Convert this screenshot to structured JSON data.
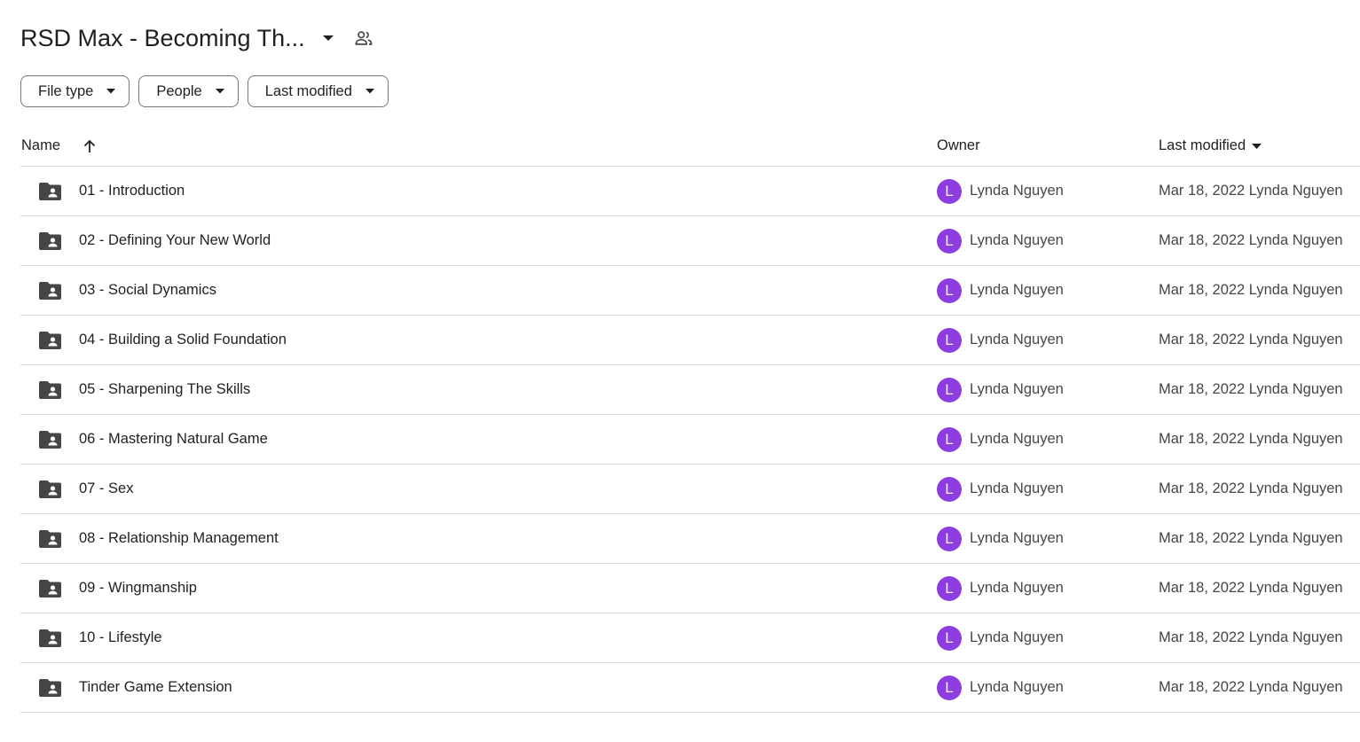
{
  "header": {
    "title": "RSD Max - Becoming Th...",
    "caret_icon": "arrow-drop-down-icon",
    "shared_icon": "people-icon"
  },
  "filters": [
    {
      "label": "File type"
    },
    {
      "label": "People"
    },
    {
      "label": "Last modified"
    }
  ],
  "table": {
    "columns": {
      "name": "Name",
      "owner": "Owner",
      "modified": "Last modified"
    },
    "sort_icon": "arrow-upward-icon",
    "rows": [
      {
        "name": "01 - Introduction",
        "owner_initial": "L",
        "owner": "Lynda Nguyen",
        "modified": "Mar 18, 2022 Lynda Nguyen"
      },
      {
        "name": "02 - Defining Your New World",
        "owner_initial": "L",
        "owner": "Lynda Nguyen",
        "modified": "Mar 18, 2022 Lynda Nguyen"
      },
      {
        "name": "03 - Social Dynamics",
        "owner_initial": "L",
        "owner": "Lynda Nguyen",
        "modified": "Mar 18, 2022 Lynda Nguyen"
      },
      {
        "name": "04 - Building a Solid Foundation",
        "owner_initial": "L",
        "owner": "Lynda Nguyen",
        "modified": "Mar 18, 2022 Lynda Nguyen"
      },
      {
        "name": "05 - Sharpening The Skills",
        "owner_initial": "L",
        "owner": "Lynda Nguyen",
        "modified": "Mar 18, 2022 Lynda Nguyen"
      },
      {
        "name": "06 - Mastering Natural Game",
        "owner_initial": "L",
        "owner": "Lynda Nguyen",
        "modified": "Mar 18, 2022 Lynda Nguyen"
      },
      {
        "name": "07 - Sex",
        "owner_initial": "L",
        "owner": "Lynda Nguyen",
        "modified": "Mar 18, 2022 Lynda Nguyen"
      },
      {
        "name": "08 - Relationship Management",
        "owner_initial": "L",
        "owner": "Lynda Nguyen",
        "modified": "Mar 18, 2022 Lynda Nguyen"
      },
      {
        "name": "09 - Wingmanship",
        "owner_initial": "L",
        "owner": "Lynda Nguyen",
        "modified": "Mar 18, 2022 Lynda Nguyen"
      },
      {
        "name": "10 - Lifestyle",
        "owner_initial": "L",
        "owner": "Lynda Nguyen",
        "modified": "Mar 18, 2022 Lynda Nguyen"
      },
      {
        "name": "Tinder Game Extension",
        "owner_initial": "L",
        "owner": "Lynda Nguyen",
        "modified": "Mar 18, 2022 Lynda Nguyen"
      }
    ]
  },
  "colors": {
    "avatar": "#8e3de0",
    "divider": "#dadce0",
    "chip_border": "#747775",
    "folder_icon": "#444746"
  }
}
